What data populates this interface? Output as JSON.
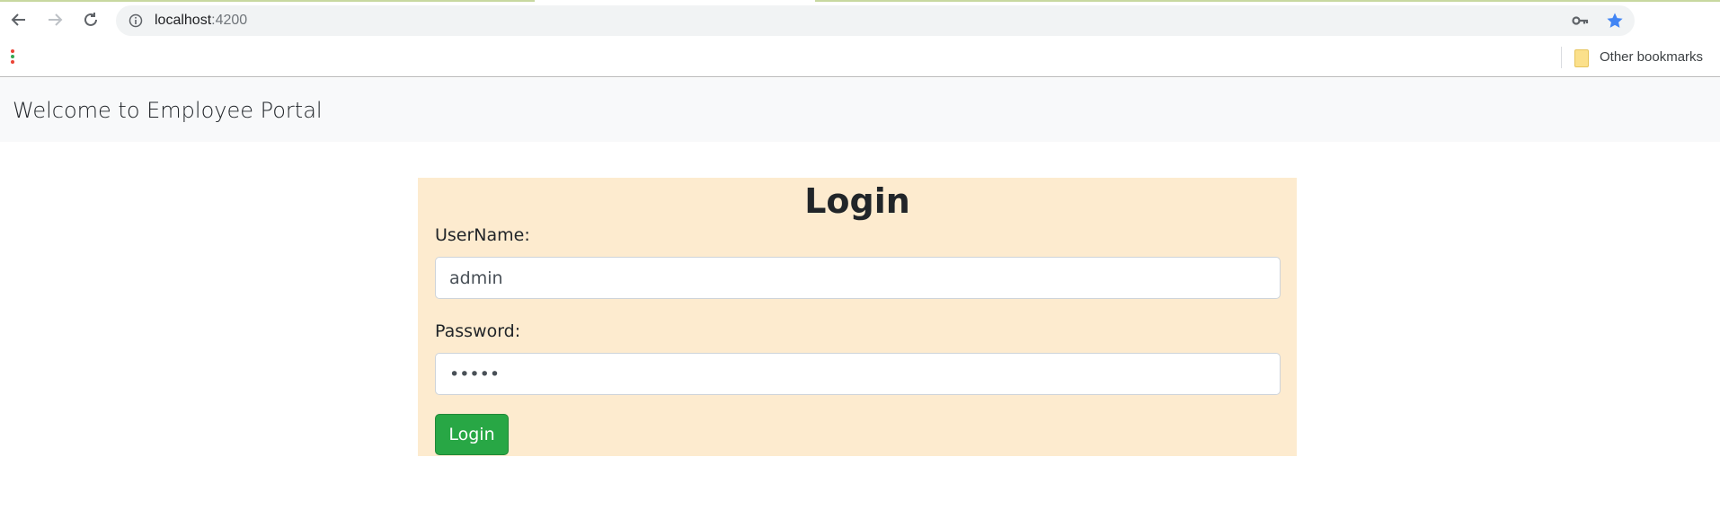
{
  "browser": {
    "url_host": "localhost",
    "url_port": ":4200",
    "bookmarks": {
      "other_label": "Other bookmarks"
    },
    "colors": {
      "star": "#4285f4",
      "apps_dot_1": "#ea4335",
      "apps_dot_2": "#34a853",
      "apps_dot_3": "#ea4335"
    }
  },
  "navbar": {
    "brand": "Welcome to Employee Portal"
  },
  "login": {
    "title": "Login",
    "username_label": "UserName:",
    "username_value": "admin",
    "password_label": "Password:",
    "password_value": "admin",
    "button_label": "Login",
    "colors": {
      "card_bg": "#fdebcf",
      "button_bg": "#28a745"
    }
  }
}
